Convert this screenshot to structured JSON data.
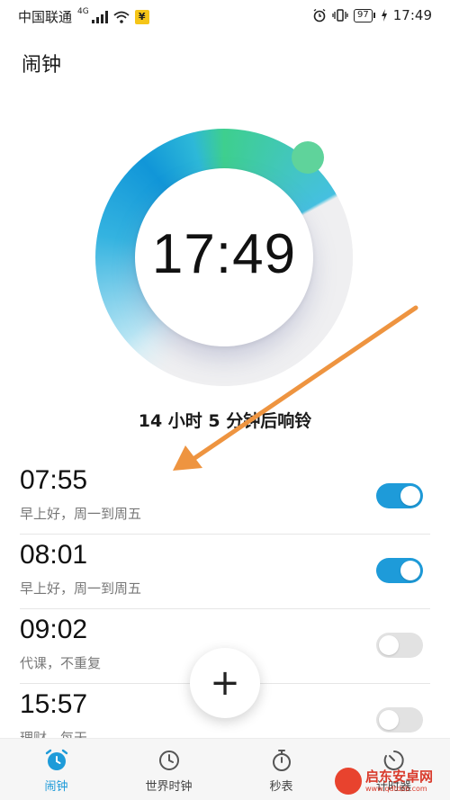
{
  "status_bar": {
    "carrier": "中国联通",
    "network_type": "4G",
    "pay_badge": "¥",
    "battery": "97",
    "time": "17:49"
  },
  "page_title": "闹钟",
  "dial": {
    "time": "17:49"
  },
  "countdown": "14 小时 5 分钟后响铃",
  "alarms": [
    {
      "time": "07:55",
      "desc": "早上好，周一到周五",
      "enabled": true
    },
    {
      "time": "08:01",
      "desc": "早上好，周一到周五",
      "enabled": true
    },
    {
      "time": "09:02",
      "desc": "代课，不重复",
      "enabled": false
    },
    {
      "time": "15:57",
      "desc": "理财，每天",
      "enabled": false
    }
  ],
  "fab": {
    "symbol": "+"
  },
  "bottom_nav": [
    {
      "label": "闹钟",
      "icon": "alarm-clock-icon",
      "active": true
    },
    {
      "label": "世界时钟",
      "icon": "world-clock-icon",
      "active": false
    },
    {
      "label": "秒表",
      "icon": "stopwatch-icon",
      "active": false
    },
    {
      "label": "计时器",
      "icon": "timer-icon",
      "active": false
    }
  ],
  "watermark": {
    "name": "启东安卓网",
    "url": "www.qdtdzb.com"
  },
  "colors": {
    "accent": "#1e9bd9",
    "ring_green": "#5fd39b",
    "annotation_arrow": "#ee9440",
    "toggle_off": "#e2e2e2"
  }
}
